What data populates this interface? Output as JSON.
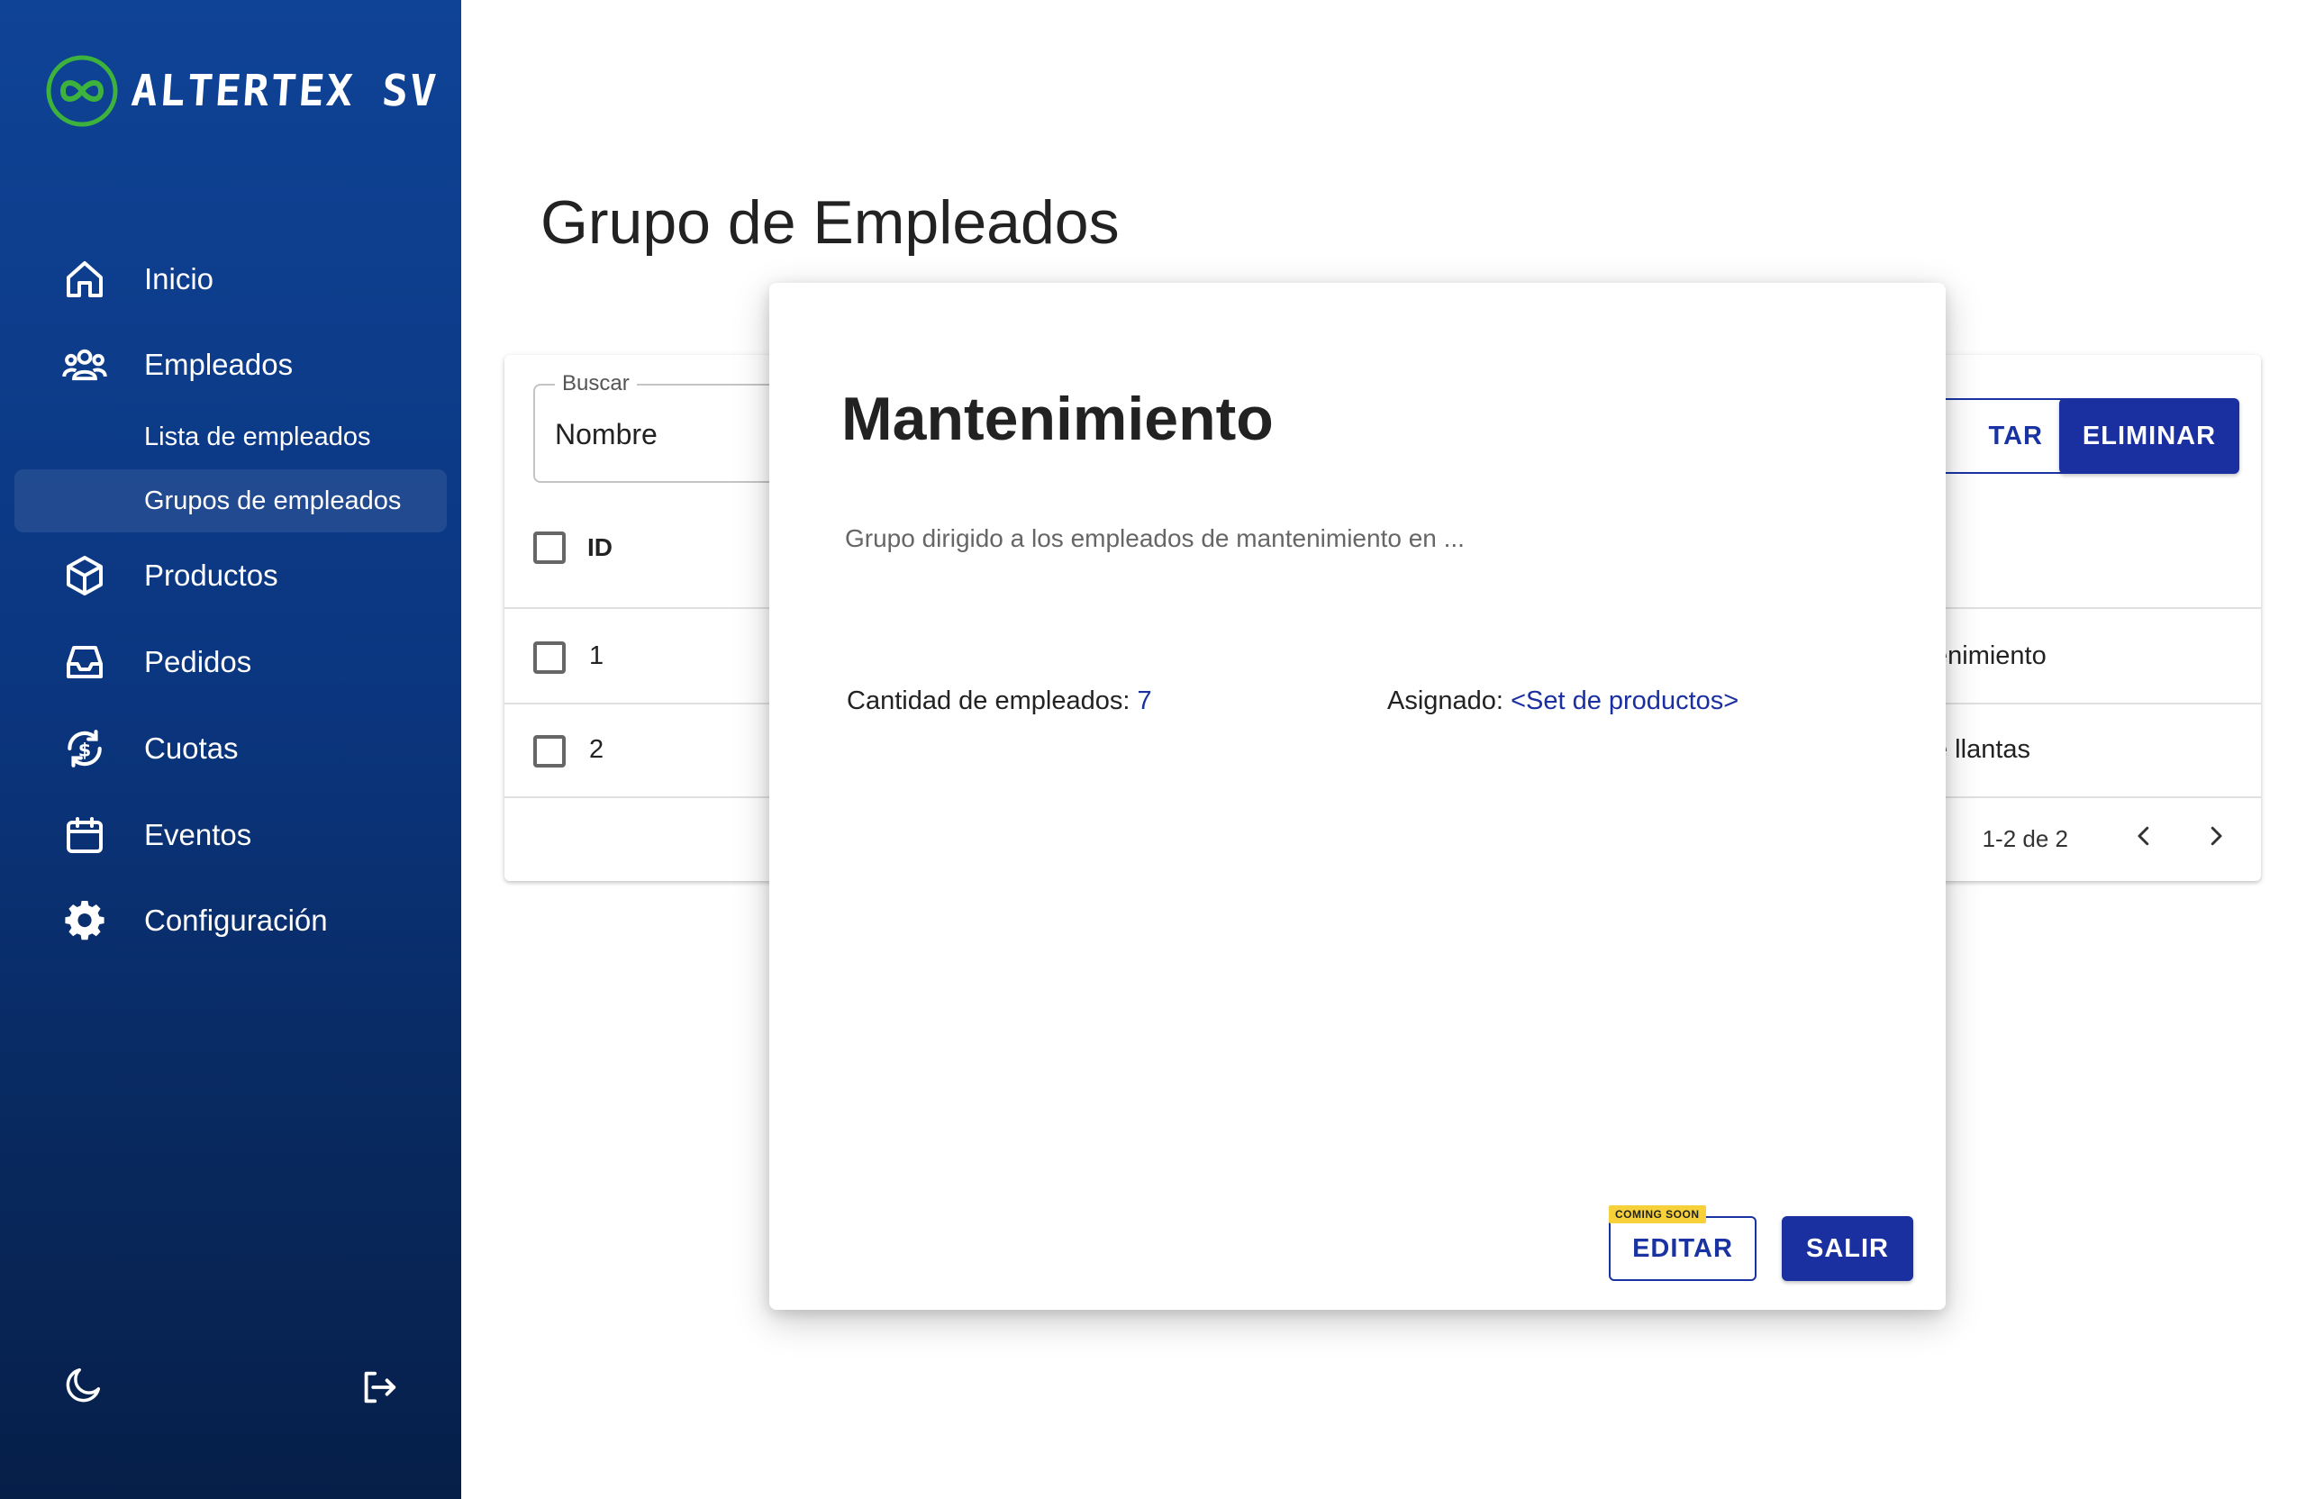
{
  "brand": {
    "name": "ALTERTEX SV",
    "accent": "#1a2fa0",
    "logo_green": "#3db23d"
  },
  "sidebar": {
    "items": [
      {
        "label": "Inicio",
        "icon": "home-icon"
      },
      {
        "label": "Empleados",
        "icon": "users-icon"
      },
      {
        "label": "Productos",
        "icon": "box-icon"
      },
      {
        "label": "Pedidos",
        "icon": "inbox-icon"
      },
      {
        "label": "Cuotas",
        "icon": "currency-cycle-icon"
      },
      {
        "label": "Eventos",
        "icon": "calendar-icon"
      },
      {
        "label": "Configuración",
        "icon": "gear-icon"
      }
    ],
    "subitems": [
      {
        "label": "Lista de empleados"
      },
      {
        "label": "Grupos de empleados",
        "active": true
      }
    ],
    "bottom": {
      "theme_icon": "moon-icon",
      "logout_icon": "logout-icon"
    }
  },
  "page": {
    "title": "Grupo de Empleados"
  },
  "search": {
    "legend": "Buscar",
    "value": "Nombre"
  },
  "toolbar": {
    "edit_label_partial": "TAR",
    "delete_label": "ELIMINAR"
  },
  "table": {
    "header_id": "ID",
    "rows": [
      {
        "id": "1",
        "name_partial": "enimiento"
      },
      {
        "id": "2",
        "name_partial": "e llantas"
      }
    ],
    "pagination": "1-2 de 2"
  },
  "modal": {
    "title": "Mantenimiento",
    "description": "Grupo dirigido a los empleados de mantenimiento en ...",
    "count_label": "Cantidad de empleados:",
    "count_value": "7",
    "assigned_label": "Asignado:",
    "assigned_value": "<Set de productos>",
    "badge": "COMING SOON",
    "edit_label": "EDITAR",
    "exit_label": "SALIR"
  }
}
